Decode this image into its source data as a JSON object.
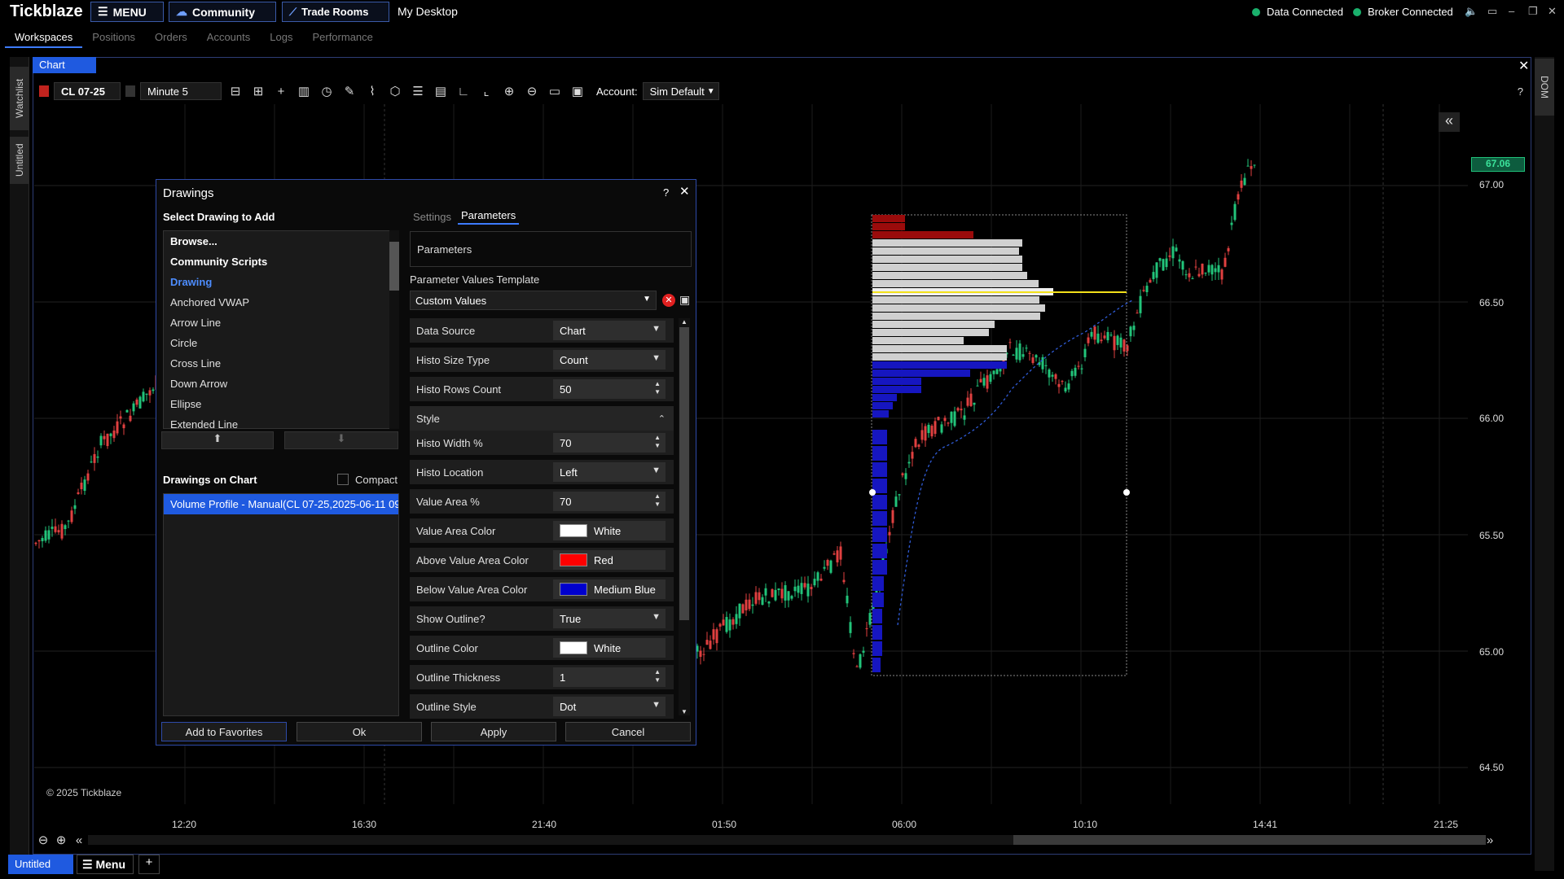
{
  "app": {
    "brand": "Tickblaze",
    "menu": "MENU",
    "community": "Community",
    "trade_rooms": "Trade Rooms",
    "my_desktop": "My Desktop",
    "data_status": "Data Connected",
    "broker_status": "Broker Connected",
    "status_color": "#1ab06c"
  },
  "nav": {
    "tabs": [
      "Workspaces",
      "Positions",
      "Orders",
      "Accounts",
      "Logs",
      "Performance"
    ]
  },
  "left_tabs": [
    "Watchlist",
    "Untitled"
  ],
  "right_tabs": [
    "DOM"
  ],
  "chart": {
    "tab": "Chart",
    "symbol": "CL 07-25",
    "timeframe": "Minute 5",
    "account_label": "Account:",
    "account": "Sim Default",
    "help": "?",
    "copyright": "© 2025 Tickblaze",
    "last_price": "67.06"
  },
  "chart_data": {
    "type": "candlestick",
    "y_ticks": [
      "67.00",
      "66.50",
      "66.00",
      "65.50",
      "65.00",
      "64.50"
    ],
    "x_ticks": [
      "12:20",
      "16:30",
      "21:40",
      "01:50",
      "06:00",
      "10:10",
      "14:41",
      "21:25"
    ],
    "ylim": [
      64.3,
      67.6
    ]
  },
  "dialog": {
    "title": "Drawings",
    "help": "?",
    "select_label": "Select Drawing to Add",
    "items": [
      {
        "label": "Browse...",
        "style": "b"
      },
      {
        "label": "Community Scripts",
        "style": "b"
      },
      {
        "label": "Drawing",
        "style": "sel"
      },
      {
        "label": "Anchored VWAP",
        "style": ""
      },
      {
        "label": "Arrow Line",
        "style": ""
      },
      {
        "label": "Circle",
        "style": ""
      },
      {
        "label": "Cross Line",
        "style": ""
      },
      {
        "label": "Down Arrow",
        "style": ""
      },
      {
        "label": "Ellipse",
        "style": ""
      },
      {
        "label": "Extended Line",
        "style": ""
      }
    ],
    "on_chart_label": "Drawings on Chart",
    "compact_label": "Compact",
    "on_chart_item": "Volume Profile - Manual(CL 07-25,2025-06-11 09",
    "tab_settings": "Settings",
    "tab_parameters": "Parameters",
    "params_header": "Parameters",
    "template_label": "Parameter Values Template",
    "template_value": "Custom Values",
    "params": [
      {
        "label": "Data Source",
        "value": "Chart",
        "kind": "dd"
      },
      {
        "label": "Histo Size Type",
        "value": "Count",
        "kind": "dd"
      },
      {
        "label": "Histo Rows Count",
        "value": "50",
        "kind": "spin"
      },
      {
        "label": "Histo Width %",
        "value": "70",
        "kind": "spin"
      },
      {
        "label": "Histo Location",
        "value": "Left",
        "kind": "dd"
      },
      {
        "label": "Value Area %",
        "value": "70",
        "kind": "spin"
      },
      {
        "label": "Value Area Color",
        "value": "White",
        "kind": "color",
        "color": "#ffffff"
      },
      {
        "label": "Above Value Area Color",
        "value": "Red",
        "kind": "color",
        "color": "#ff0000"
      },
      {
        "label": "Below Value Area Color",
        "value": "Medium Blue",
        "kind": "color",
        "color": "#0000cd"
      },
      {
        "label": "Show Outline?",
        "value": "True",
        "kind": "dd"
      },
      {
        "label": "Outline Color",
        "value": "White",
        "kind": "color",
        "color": "#ffffff"
      },
      {
        "label": "Outline Thickness",
        "value": "1",
        "kind": "spin"
      },
      {
        "label": "Outline Style",
        "value": "Dot",
        "kind": "dd"
      }
    ],
    "style_section": "Style",
    "buttons": {
      "favorites": "Add to Favorites",
      "ok": "Ok",
      "apply": "Apply",
      "cancel": "Cancel"
    }
  },
  "bottom": {
    "workspace": "Untitled",
    "menu": "Menu",
    "add": "+"
  }
}
